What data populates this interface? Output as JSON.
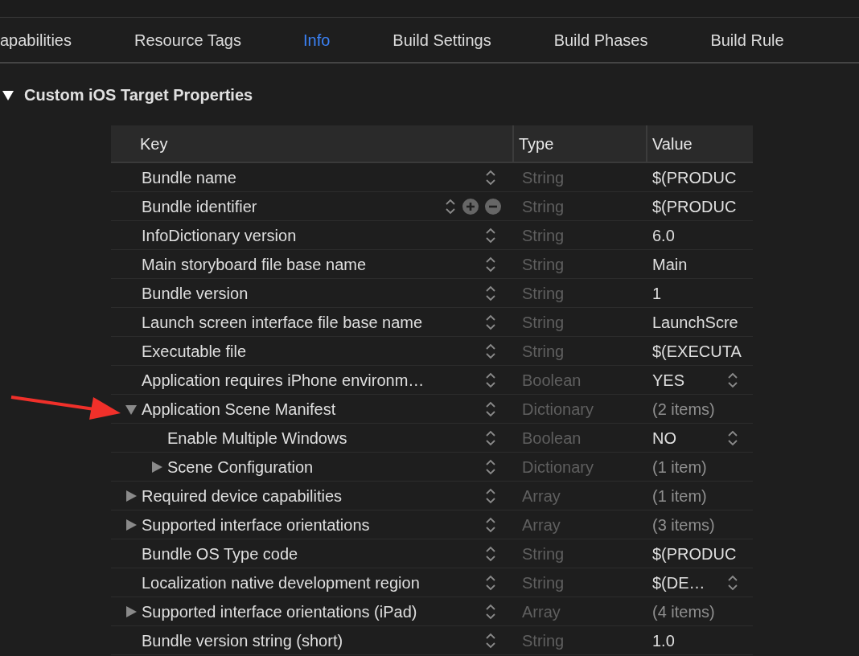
{
  "tabs": [
    {
      "label": "apabilities",
      "selected": false
    },
    {
      "label": "Resource Tags",
      "selected": false
    },
    {
      "label": "Info",
      "selected": true
    },
    {
      "label": "Build Settings",
      "selected": false
    },
    {
      "label": "Build Phases",
      "selected": false
    },
    {
      "label": "Build Rule",
      "selected": false
    }
  ],
  "section": {
    "title": "Custom iOS Target Properties",
    "expanded": true
  },
  "table": {
    "columns": [
      "Key",
      "Type",
      "Value"
    ],
    "rows": [
      {
        "key": "Bundle name",
        "type": "String",
        "value": "$(PRODUC",
        "kind": "string",
        "popup": false,
        "hovered": false
      },
      {
        "key": "Bundle identifier",
        "type": "String",
        "value": "$(PRODUC",
        "kind": "string",
        "popup": false,
        "hovered": true
      },
      {
        "key": "InfoDictionary version",
        "type": "String",
        "value": "6.0",
        "kind": "string",
        "popup": false,
        "hovered": false
      },
      {
        "key": "Main storyboard file base name",
        "type": "String",
        "value": "Main",
        "kind": "string",
        "popup": false,
        "hovered": false
      },
      {
        "key": "Bundle version",
        "type": "String",
        "value": "1",
        "kind": "string",
        "popup": false,
        "hovered": false
      },
      {
        "key": "Launch screen interface file base name",
        "type": "String",
        "value": "LaunchScre",
        "kind": "string",
        "popup": false,
        "hovered": false
      },
      {
        "key": "Executable file",
        "type": "String",
        "value": "$(EXECUTA",
        "kind": "string",
        "popup": false,
        "hovered": false
      },
      {
        "key": "Application requires iPhone environm…",
        "type": "Boolean",
        "value": "YES",
        "kind": "boolean",
        "popup": true,
        "hovered": false
      },
      {
        "key": "Application Scene Manifest",
        "type": "Dictionary",
        "value": "(2 items)",
        "kind": "container",
        "popup": false,
        "hovered": false,
        "expanded": true,
        "children": [
          {
            "key": "Enable Multiple Windows",
            "type": "Boolean",
            "value": "NO",
            "kind": "boolean",
            "popup": true,
            "hovered": false
          },
          {
            "key": "Scene Configuration",
            "type": "Dictionary",
            "value": "(1 item)",
            "kind": "container",
            "popup": false,
            "hovered": false,
            "expanded": false
          }
        ]
      },
      {
        "key": "Required device capabilities",
        "type": "Array",
        "value": "(1 item)",
        "kind": "container",
        "popup": false,
        "hovered": false,
        "expanded": false
      },
      {
        "key": "Supported interface orientations",
        "type": "Array",
        "value": "(3 items)",
        "kind": "container",
        "popup": false,
        "hovered": false,
        "expanded": false
      },
      {
        "key": "Bundle OS Type code",
        "type": "String",
        "value": "$(PRODUC",
        "kind": "string",
        "popup": false,
        "hovered": false
      },
      {
        "key": "Localization native development region",
        "type": "String",
        "value": "$(DE…",
        "kind": "string",
        "popup": true,
        "hovered": false
      },
      {
        "key": "Supported interface orientations (iPad)",
        "type": "Array",
        "value": "(4 items)",
        "kind": "container",
        "popup": false,
        "hovered": false,
        "expanded": false
      },
      {
        "key": "Bundle version string (short)",
        "type": "String",
        "value": "1.0",
        "kind": "string",
        "popup": false,
        "hovered": false
      }
    ]
  }
}
